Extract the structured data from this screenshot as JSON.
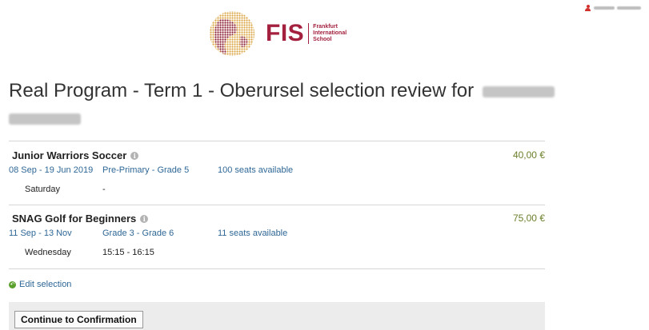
{
  "header": {
    "logo_main": "FIS",
    "logo_sub": [
      "Frankfurt",
      "International",
      "School"
    ],
    "user_icon": "user-icon"
  },
  "page": {
    "title": "Real Program - Term 1 - Oberursel selection review for"
  },
  "courses": [
    {
      "name": "Junior Warriors Soccer",
      "price": "40,00 €",
      "dates": "08 Sep - 19 Jun 2019",
      "grades": "Pre-Primary - Grade 5",
      "seats": "100 seats available",
      "day": "Saturday",
      "time": "-"
    },
    {
      "name": "SNAG Golf for Beginners",
      "price": "75,00 €",
      "dates": "11 Sep - 13 Nov",
      "grades": "Grade 3 - Grade 6",
      "seats": "11 seats available",
      "day": "Wednesday",
      "time": "15:15 - 16:15"
    }
  ],
  "actions": {
    "edit_label": "Edit selection",
    "continue_label": "Continue to Confirmation"
  },
  "colors": {
    "brand": "#a3213e",
    "link": "#2f6796",
    "price": "#6a7f2a"
  }
}
